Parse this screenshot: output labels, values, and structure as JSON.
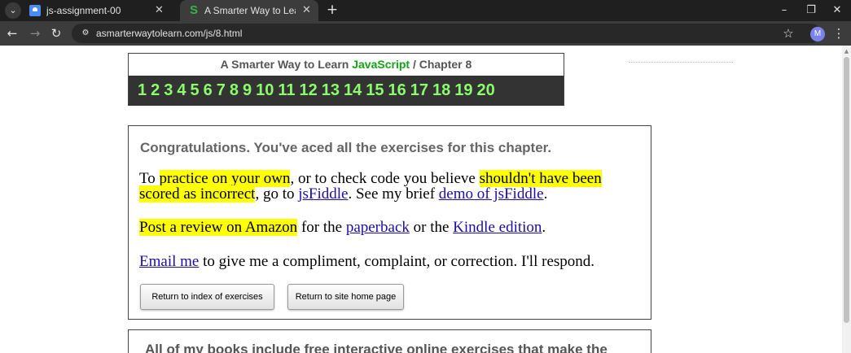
{
  "browser": {
    "tabs": [
      {
        "title": "js-assignment-00",
        "favicon": "document-icon",
        "active": false
      },
      {
        "title": "A Smarter Way to Learn JavaScr",
        "favicon": "S",
        "active": true
      }
    ],
    "new_tab": "+",
    "window_controls": {
      "minimize": "–",
      "restore": "❐",
      "close": "✕"
    },
    "url": "asmarterwaytolearn.com/js/8.html",
    "profile_initial": "M",
    "icons": {
      "back": "←",
      "forward": "→",
      "reload": "↻",
      "site_info": "⚙",
      "star": "☆",
      "menu": "⋮",
      "tab_close": "✕",
      "tab_search": "⌄",
      "scroll_up": "▲"
    }
  },
  "header": {
    "title_prefix": "A Smarter Way to Learn",
    "title_language": "JavaScript",
    "title_suffix": " / Chapter 8",
    "accent_color": "#13a513",
    "chapters": [
      "1",
      "2",
      "3",
      "4",
      "5",
      "6",
      "7",
      "8",
      "9",
      "10",
      "11",
      "12",
      "13",
      "14",
      "15",
      "16",
      "17",
      "18",
      "19",
      "20"
    ],
    "chapter_link_color": "#8bfc6c",
    "strip_background": "#333333"
  },
  "congrats": {
    "heading": "Congratulations. You've aced all the exercises for this chapter.",
    "p1": {
      "t1": "To ",
      "h1": "practice on your own",
      "t2": ", or to check code you believe ",
      "h2a": "shouldn't have been",
      "h2b": "scored as incorrect",
      "t3": ", go to ",
      "link1": "jsFiddle",
      "t4": ". See my brief ",
      "link2": "demo of jsFiddle",
      "t5": "."
    },
    "p2": {
      "h1": "Post a review on Amazon",
      "t1": " for the ",
      "link1": "paperback",
      "t2": " or the ",
      "link2": "Kindle edition",
      "t3": "."
    },
    "p3": {
      "link1": "Email me",
      "t1": " to give me a compliment, complaint, or correction. I'll respond."
    },
    "buttons": {
      "index": "Return to index of exercises",
      "home": "Return to site home page"
    },
    "highlight_color": "#ffff00",
    "link_color": "#1a0dab"
  },
  "promo": {
    "text": "All of my books include free interactive online exercises that make the"
  }
}
